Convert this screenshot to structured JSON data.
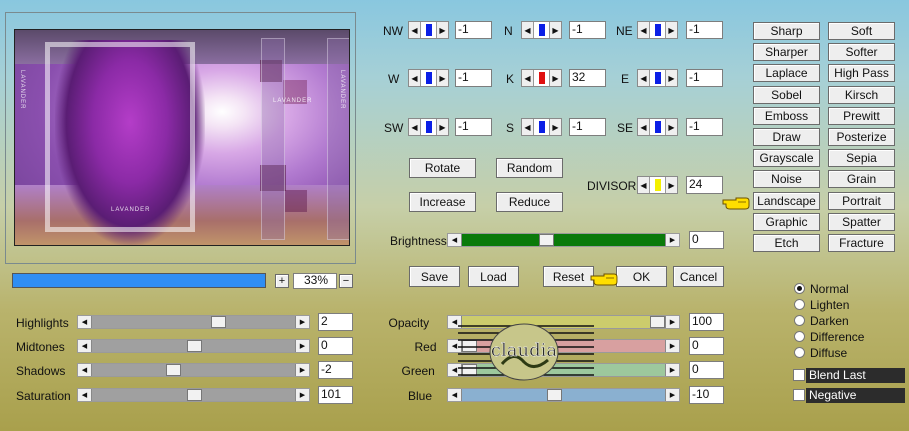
{
  "compass": {
    "NW": {
      "label": "NW",
      "value": "-1",
      "color": "#0b1fe6"
    },
    "N": {
      "label": "N",
      "value": "-1",
      "color": "#0b1fe6"
    },
    "NE": {
      "label": "NE",
      "value": "-1",
      "color": "#0b1fe6"
    },
    "W": {
      "label": "W",
      "value": "-1",
      "color": "#0b1fe6"
    },
    "K": {
      "label": "K",
      "value": "32",
      "color": "#e01010"
    },
    "E": {
      "label": "E",
      "value": "-1",
      "color": "#0b1fe6"
    },
    "SW": {
      "label": "SW",
      "value": "-1",
      "color": "#0b1fe6"
    },
    "S": {
      "label": "S",
      "value": "-1",
      "color": "#0b1fe6"
    },
    "SE": {
      "label": "SE",
      "value": "-1",
      "color": "#0b1fe6"
    }
  },
  "actions": {
    "rotate": "Rotate",
    "random": "Random",
    "increase": "Increase",
    "reduce": "Reduce"
  },
  "divisor": {
    "label": "DIVISOR",
    "value": "24",
    "color": "#f4f000"
  },
  "brightness": {
    "label": "Brightness",
    "value": "0",
    "fill_color": "#0a7a0a",
    "level": 0.38
  },
  "bottom_buttons": {
    "save": "Save",
    "load": "Load",
    "reset": "Reset",
    "ok": "OK",
    "cancel": "Cancel"
  },
  "zoom": {
    "plus": "+",
    "value": "33%",
    "minus": "−",
    "progress": 1.0
  },
  "presets": [
    {
      "left": "Sharp",
      "right": "Soft"
    },
    {
      "left": "Sharper",
      "right": "Softer"
    },
    {
      "left": "Laplace",
      "right": "High Pass"
    },
    {
      "left": "Sobel",
      "right": "Kirsch"
    },
    {
      "left": "Emboss",
      "right": "Prewitt"
    },
    {
      "left": "Draw",
      "right": "Posterize"
    },
    {
      "left": "Grayscale",
      "right": "Sepia"
    },
    {
      "left": "Noise",
      "right": "Grain"
    },
    {
      "left": "Landscape",
      "right": "Portrait"
    },
    {
      "left": "Graphic",
      "right": "Spatter"
    },
    {
      "left": "Etch",
      "right": "Fracture"
    }
  ],
  "tone": [
    {
      "label": "Highlights",
      "value": "2",
      "level": 0.62
    },
    {
      "label": "Midtones",
      "value": "0",
      "level": 0.5
    },
    {
      "label": "Shadows",
      "value": "-2",
      "level": 0.4
    },
    {
      "label": "Saturation",
      "value": "101",
      "level": 0.5
    }
  ],
  "color_sliders": [
    {
      "label": "Opacity",
      "value": "100",
      "color": "#cccc6c",
      "level": 1.0
    },
    {
      "label": "Red",
      "value": "0",
      "color": "#d8a0a0",
      "level": 0.0
    },
    {
      "label": "Green",
      "value": "0",
      "color": "#9dc89d",
      "level": 0.0
    },
    {
      "label": "Blue",
      "value": "-10",
      "color": "#8ab0d0",
      "level": 0.45
    }
  ],
  "blend": {
    "options": [
      "Normal",
      "Lighten",
      "Darken",
      "Difference",
      "Diffuse"
    ],
    "selected": "Normal"
  },
  "checks": {
    "blend_last": "Blend Last",
    "negative": "Negative"
  },
  "preview": {
    "text_left": "LAVANDER",
    "text_right": "LAVANDER",
    "text_center": "LAVANDER",
    "text_bottom": "LAVANDER"
  },
  "watermark": {
    "text": "claudia"
  }
}
